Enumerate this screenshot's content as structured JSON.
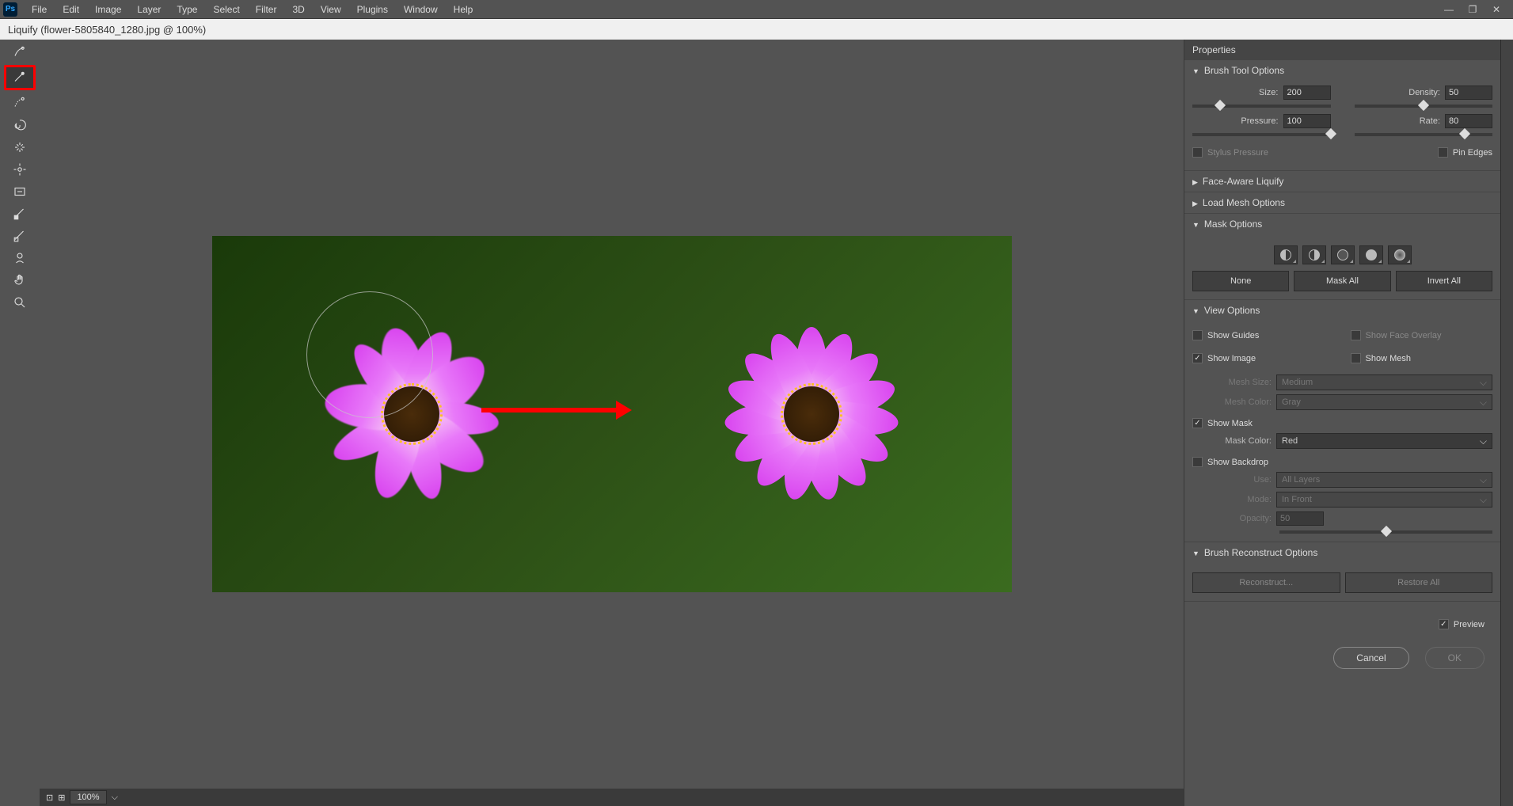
{
  "menubar": {
    "items": [
      "File",
      "Edit",
      "Image",
      "Layer",
      "Type",
      "Select",
      "Filter",
      "3D",
      "View",
      "Plugins",
      "Window",
      "Help"
    ]
  },
  "title": "Liquify (flower-5805840_1280.jpg @ 100%)",
  "toolbar": {
    "tools": [
      {
        "name": "forward-warp",
        "selected": false
      },
      {
        "name": "reconstruct",
        "selected": true
      },
      {
        "name": "smooth",
        "selected": false
      },
      {
        "name": "twirl",
        "selected": false
      },
      {
        "name": "pucker",
        "selected": false
      },
      {
        "name": "bloat",
        "selected": false
      },
      {
        "name": "push-left",
        "selected": false
      },
      {
        "name": "freeze-mask",
        "selected": false
      },
      {
        "name": "thaw-mask",
        "selected": false
      },
      {
        "name": "face",
        "selected": false
      },
      {
        "name": "hand",
        "selected": false
      },
      {
        "name": "zoom",
        "selected": false
      }
    ]
  },
  "bottombar": {
    "zoom": "100%"
  },
  "properties": {
    "title": "Properties",
    "brush": {
      "title": "Brush Tool Options",
      "size_label": "Size:",
      "size": "200",
      "density_label": "Density:",
      "density": "50",
      "pressure_label": "Pressure:",
      "pressure": "100",
      "rate_label": "Rate:",
      "rate": "80",
      "stylus": "Stylus Pressure",
      "pin_edges": "Pin Edges"
    },
    "face": {
      "title": "Face-Aware Liquify"
    },
    "load_mesh": {
      "title": "Load Mesh Options"
    },
    "mask": {
      "title": "Mask Options",
      "none": "None",
      "mask_all": "Mask All",
      "invert_all": "Invert All"
    },
    "view": {
      "title": "View Options",
      "show_guides": "Show Guides",
      "show_face_overlay": "Show Face Overlay",
      "show_image": "Show Image",
      "show_mesh": "Show Mesh",
      "mesh_size_label": "Mesh Size:",
      "mesh_size": "Medium",
      "mesh_color_label": "Mesh Color:",
      "mesh_color": "Gray",
      "show_mask": "Show Mask",
      "mask_color_label": "Mask Color:",
      "mask_color": "Red",
      "show_backdrop": "Show Backdrop",
      "use_label": "Use:",
      "use": "All Layers",
      "mode_label": "Mode:",
      "mode": "In Front",
      "opacity_label": "Opacity:",
      "opacity": "50"
    },
    "reconstruct": {
      "title": "Brush Reconstruct Options",
      "reconstruct_btn": "Reconstruct...",
      "restore_btn": "Restore All"
    },
    "preview": "Preview",
    "cancel": "Cancel",
    "ok": "OK"
  }
}
